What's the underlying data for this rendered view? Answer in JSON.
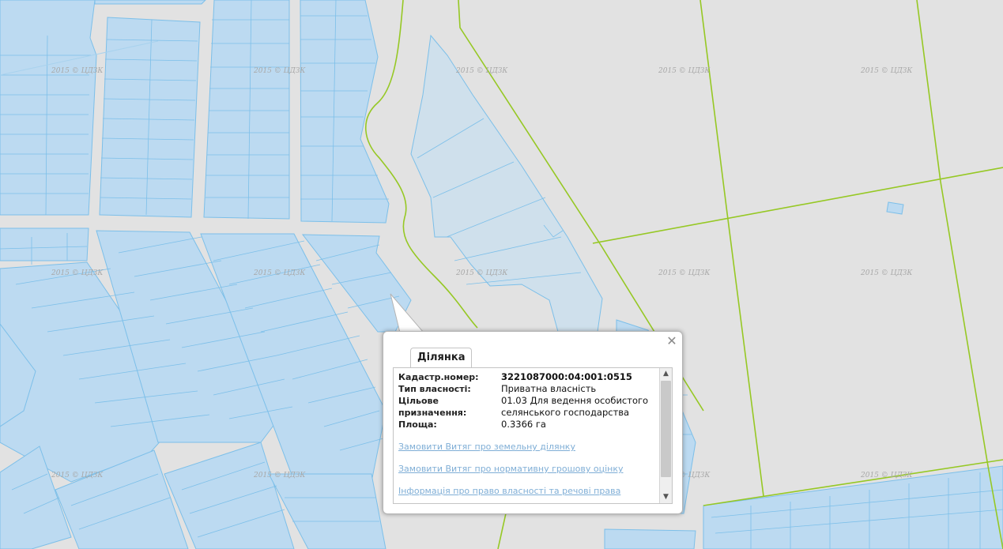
{
  "map": {
    "watermark_text": "2015 © ЦДЗК",
    "parcel_fill": "#bcdaf1",
    "parcel_stroke": "#7cbfe9",
    "boundary_color": "#96c824",
    "road_color": "#e2e2e2"
  },
  "popup": {
    "tab_label": "Ділянка",
    "close_icon": "close-icon",
    "fields": [
      {
        "label": "Кадастр.номер:",
        "value": "3221087000:04:001:0515",
        "bold": true
      },
      {
        "label": "Тип власності:",
        "value": "Приватна власність"
      },
      {
        "label": "Цільове призначення:",
        "value": "01.03 Для ведення особистого селянського господарства"
      },
      {
        "label": "Площа:",
        "value": "0.3366 га"
      }
    ],
    "links": [
      "Замовити Витяг про земельну ділянку",
      "Замовити Витяг про нормативну грошову оцінку",
      "Інформація про право власності та речові права"
    ]
  }
}
